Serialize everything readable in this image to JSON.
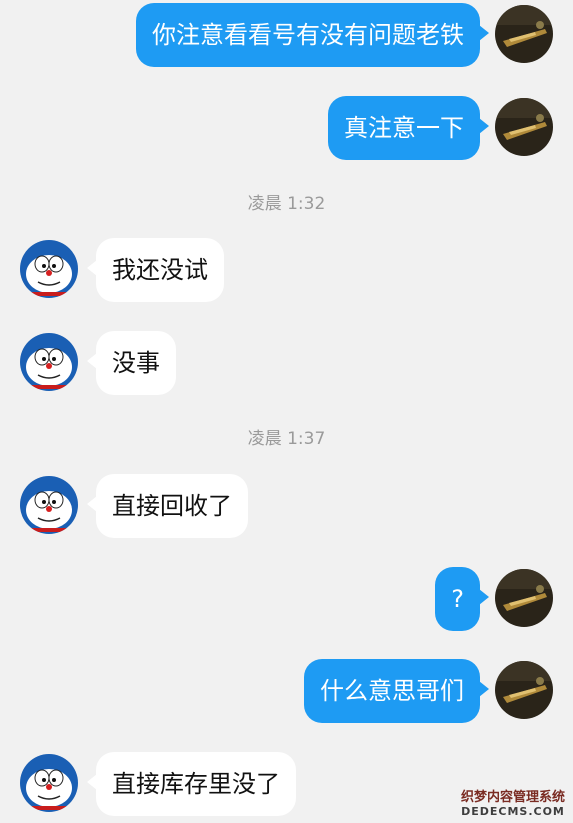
{
  "messages": [
    {
      "direction": "out",
      "text": "你注意看看号有没有问题老铁"
    },
    {
      "direction": "out",
      "text": "真注意一下"
    },
    {
      "type": "time",
      "text": "凌晨 1:32"
    },
    {
      "direction": "in",
      "text": "我还没试"
    },
    {
      "direction": "in",
      "text": "没事"
    },
    {
      "type": "time",
      "text": "凌晨 1:37"
    },
    {
      "direction": "in",
      "text": "直接回收了"
    },
    {
      "direction": "out",
      "text": "?"
    },
    {
      "direction": "out",
      "text": "什么意思哥们"
    },
    {
      "direction": "in",
      "text": "直接库存里没了"
    }
  ],
  "watermark": {
    "line1": "织梦内容管理系统",
    "line2": "DEDECMS.COM"
  },
  "colors": {
    "outgoing_bubble": "#1e9bf3",
    "incoming_bubble": "#ffffff",
    "background": "#f1f1f1",
    "timestamp": "#9a9a9a"
  },
  "icons": {
    "outgoing_avatar": "dark-game-weapon-avatar",
    "incoming_avatar": "doraemon-avatar"
  }
}
